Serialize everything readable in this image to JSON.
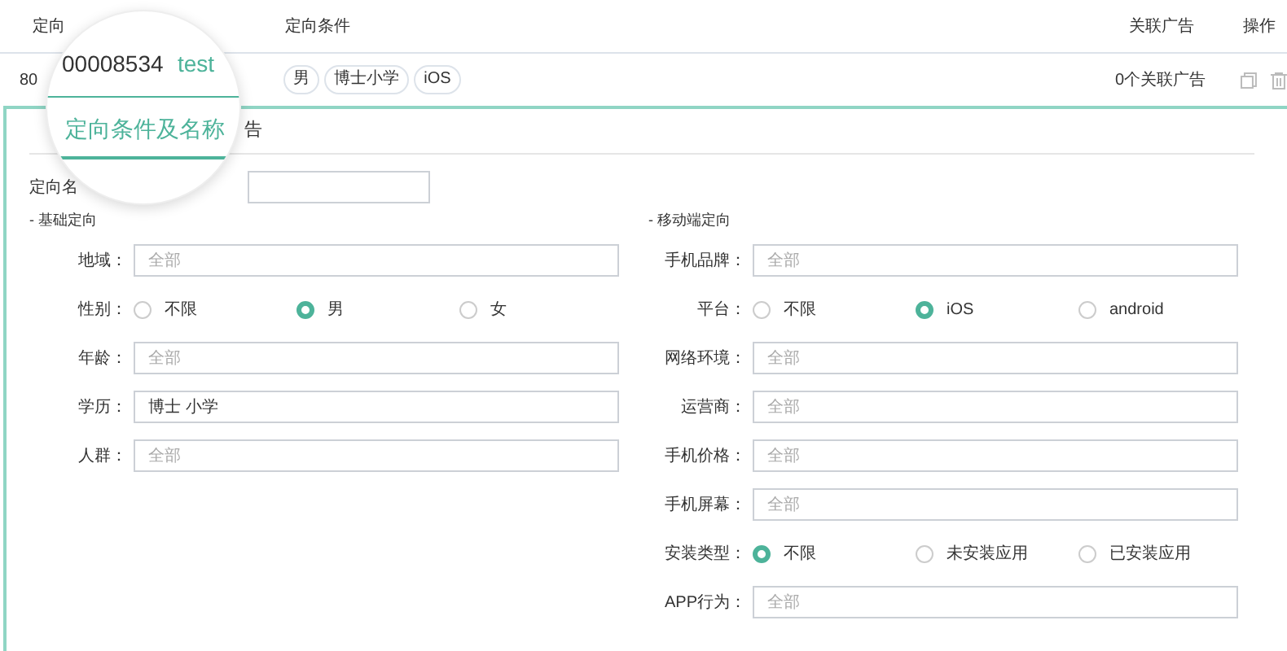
{
  "table": {
    "columns": [
      "定向",
      "定向条件",
      "关联广告",
      "操作"
    ],
    "rows": [
      {
        "id": "80",
        "tags": [
          "男",
          "博士小学",
          "iOS"
        ],
        "ads": "0个关联广告"
      }
    ]
  },
  "tabs": [
    {
      "label": "告",
      "selected": false
    }
  ],
  "name_field": {
    "label": "定向名"
  },
  "basic": {
    "title": "- 基础定向",
    "fields": [
      {
        "kind": "input",
        "label": "地域：",
        "placeholder": "全部"
      },
      {
        "kind": "radio",
        "label": "性别：",
        "options": [
          {
            "label": "不限",
            "selected": false
          },
          {
            "label": "男",
            "selected": true
          },
          {
            "label": "女",
            "selected": false
          }
        ]
      },
      {
        "kind": "input",
        "label": "年龄：",
        "placeholder": "全部"
      },
      {
        "kind": "input",
        "label": "学历：",
        "value": "博士 小学"
      },
      {
        "kind": "input",
        "label": "人群：",
        "placeholder": "全部"
      }
    ]
  },
  "mobile": {
    "title": "- 移动端定向",
    "fields": [
      {
        "kind": "input",
        "label": "手机品牌：",
        "placeholder": "全部"
      },
      {
        "kind": "radio",
        "label": "平台：",
        "options": [
          {
            "label": "不限",
            "selected": false
          },
          {
            "label": "iOS",
            "selected": true
          },
          {
            "label": "android",
            "selected": false
          }
        ]
      },
      {
        "kind": "input",
        "label": "网络环境：",
        "placeholder": "全部"
      },
      {
        "kind": "input",
        "label": "运营商：",
        "placeholder": "全部"
      },
      {
        "kind": "input",
        "label": "手机价格：",
        "placeholder": "全部"
      },
      {
        "kind": "input",
        "label": "手机屏幕：",
        "placeholder": "全部"
      },
      {
        "kind": "radio",
        "label": "安装类型：",
        "options": [
          {
            "label": "不限",
            "selected": true
          },
          {
            "label": "未安装应用",
            "selected": false
          },
          {
            "label": "已安装应用",
            "selected": false
          }
        ]
      },
      {
        "kind": "input",
        "label": "APP行为：",
        "placeholder": "全部"
      }
    ]
  },
  "magnifier": {
    "id": "00008534",
    "name": "test",
    "tab": {
      "label": "定向条件及名称",
      "selected": true
    }
  }
}
